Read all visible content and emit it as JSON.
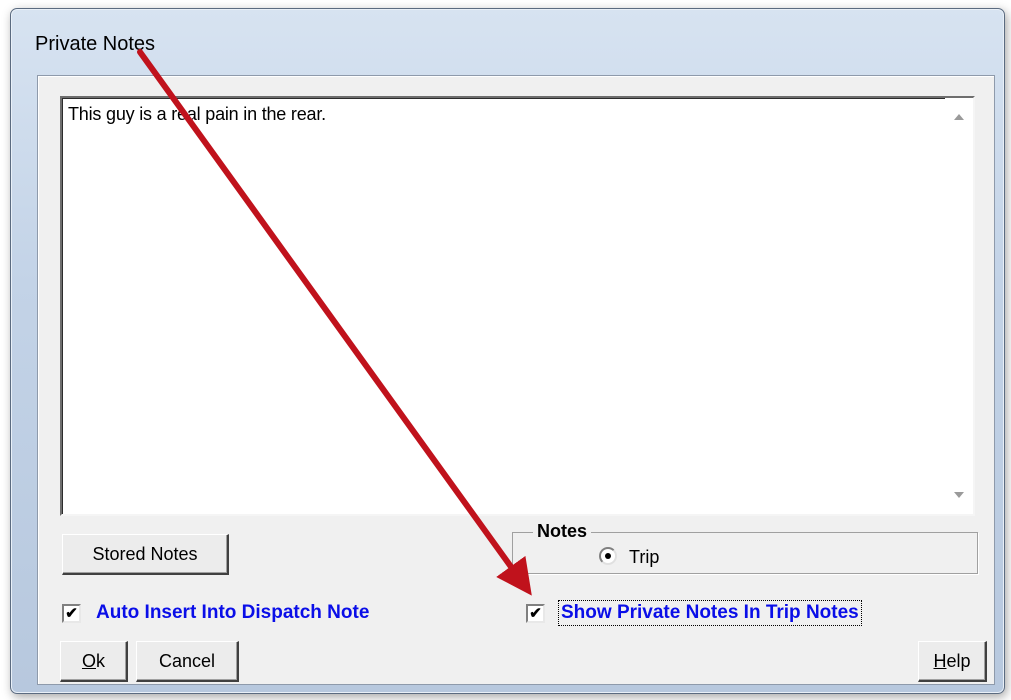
{
  "window": {
    "title": "Private Notes"
  },
  "notes": {
    "text": "This guy is a real pain in the rear."
  },
  "buttons": {
    "stored_notes": "Stored Notes",
    "ok_accel": "O",
    "ok_rest": "k",
    "cancel": "Cancel",
    "help_accel": "H",
    "help_rest": "elp"
  },
  "notes_group": {
    "legend": "Notes",
    "radio_label": "Trip",
    "radio_selected": true
  },
  "options": {
    "auto_insert": {
      "label": "Auto Insert Into Dispatch Note",
      "checked": true
    },
    "show_private": {
      "label": "Show Private Notes In Trip Notes",
      "checked": true
    }
  },
  "colors": {
    "annotation_arrow": "#c0121c",
    "option_label": "#0a0ee8"
  }
}
